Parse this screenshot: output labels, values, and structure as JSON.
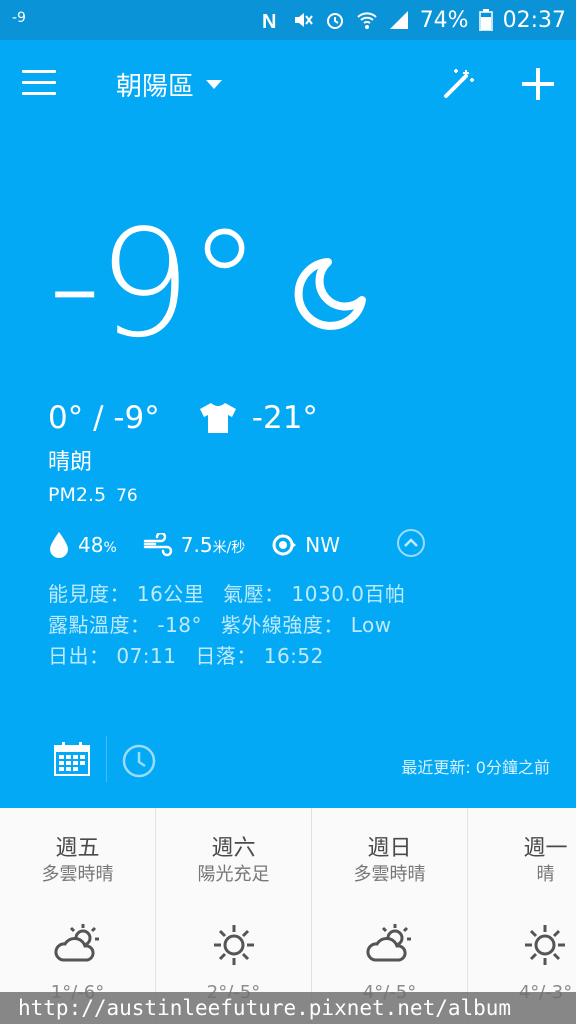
{
  "status_bar": {
    "left_text": "-9",
    "battery": "74%",
    "time": "02:37",
    "icons": [
      "nfc-icon",
      "mute-icon",
      "alarm-icon",
      "wifi-icon",
      "signal-icon",
      "battery-icon"
    ]
  },
  "toolbar": {
    "location": "朝陽區",
    "icons": [
      "menu-icon",
      "magic-wand-icon",
      "plus-icon"
    ]
  },
  "current": {
    "temperature": "-9°",
    "high_low": "0° / -9°",
    "feels_like": "-21°",
    "condition": "晴朗",
    "pm25_label": "PM2.5",
    "pm25_value": "76",
    "humidity_value": "48",
    "humidity_unit": "%",
    "wind_value": "7.5",
    "wind_unit": "米/秒",
    "wind_direction": "NW"
  },
  "details": {
    "visibility_label": "能見度：",
    "visibility_value": "16公里",
    "pressure_label": "氣壓：",
    "pressure_value": "1030.0百帕",
    "dewpoint_label": "露點溫度：",
    "dewpoint_value": "-18°",
    "uv_label": "紫外線強度：",
    "uv_value": "Low",
    "sunrise_label": "日出：",
    "sunrise_value": "07:11",
    "sunset_label": "日落：",
    "sunset_value": "16:52"
  },
  "footer": {
    "updated": "最近更新: 0分鐘之前"
  },
  "forecast": [
    {
      "day": "週五",
      "desc": "多雲時晴",
      "temps": "1°/-6°",
      "icon": "partly-cloudy-icon"
    },
    {
      "day": "週六",
      "desc": "陽光充足",
      "temps": "2°/-5°",
      "icon": "sunny-icon"
    },
    {
      "day": "週日",
      "desc": "多雲時晴",
      "temps": "4°/-5°",
      "icon": "partly-cloudy-icon"
    },
    {
      "day": "週一",
      "desc": "晴",
      "temps": "4°/-3°",
      "icon": "sunny-icon"
    }
  ],
  "watermark": "http://austinleefuture.pixnet.net/album",
  "colors": {
    "status_bar": "#0a93d6",
    "main": "#03a9f4",
    "forecast_bg": "#fafafa"
  }
}
